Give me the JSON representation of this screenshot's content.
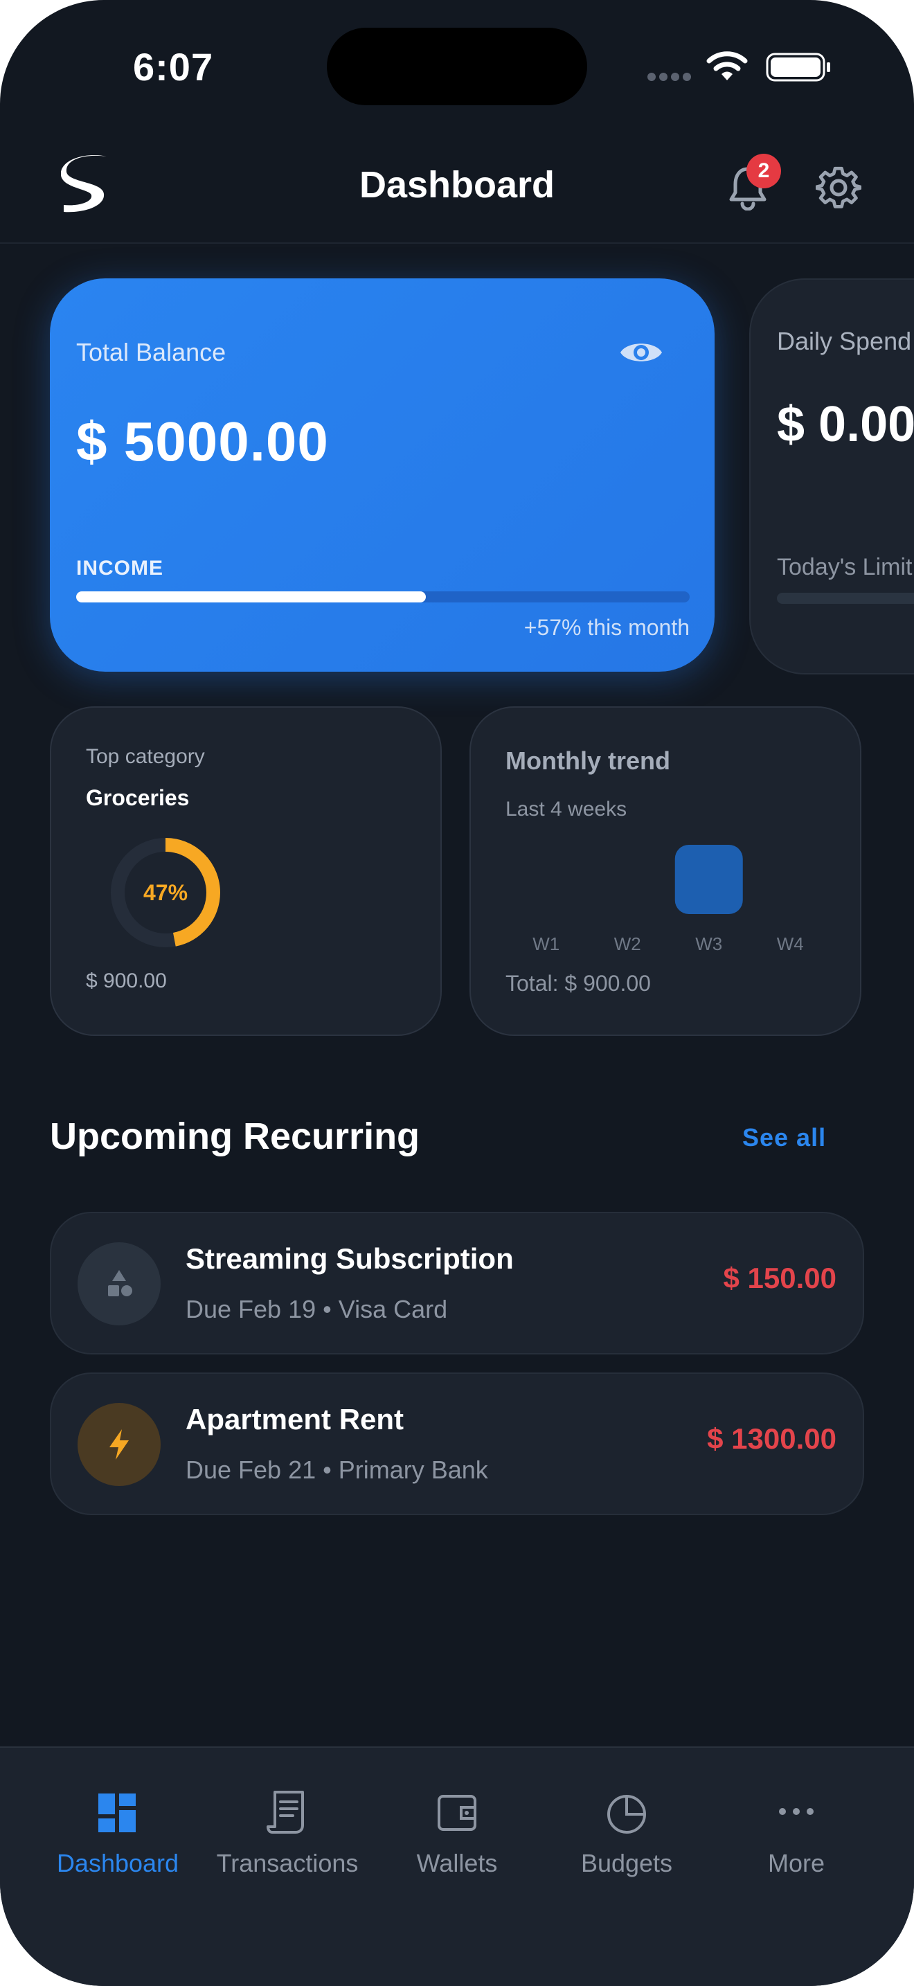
{
  "status_bar": {
    "time": "6:07"
  },
  "header": {
    "title": "Dashboard",
    "notification_count": "2"
  },
  "balance_card": {
    "label": "Total Balance",
    "amount": "$ 5000.00",
    "income_label": "INCOME",
    "income_progress": 0.57,
    "change_text": "+57% this month"
  },
  "daily_card": {
    "label": "Daily Spend",
    "amount": "$ 0.00",
    "limit_label": "Today's Limit"
  },
  "top_category": {
    "title": "Top category",
    "name": "Groceries",
    "percent_label": "47%",
    "percent": 0.47,
    "amount": "$ 900.00"
  },
  "monthly_trend": {
    "title": "Monthly trend",
    "subtitle": "Last 4 weeks",
    "total": "Total: $ 900.00"
  },
  "chart_data": {
    "type": "bar",
    "categories": [
      "W1",
      "W2",
      "W3",
      "W4"
    ],
    "values": [
      0,
      0,
      900,
      0
    ],
    "title": "Monthly trend",
    "xlabel": "",
    "ylabel": ""
  },
  "upcoming": {
    "title": "Upcoming Recurring",
    "see_all": "See all",
    "items": [
      {
        "name": "Streaming Subscription",
        "due": "Due Feb 19",
        "account": "Visa Card",
        "amount": "$ 150.00",
        "icon": "shapes-icon"
      },
      {
        "name": "Apartment Rent",
        "due": "Due Feb 21",
        "account": "Primary Bank",
        "amount": "$ 1300.00",
        "icon": "bolt-icon"
      }
    ]
  },
  "nav": {
    "items": [
      {
        "label": "Dashboard",
        "icon": "dashboard-icon",
        "active": true
      },
      {
        "label": "Transactions",
        "icon": "receipt-icon",
        "active": false
      },
      {
        "label": "Wallets",
        "icon": "wallet-icon",
        "active": false
      },
      {
        "label": "Budgets",
        "icon": "pie-chart-icon",
        "active": false
      },
      {
        "label": "More",
        "icon": "more-icon",
        "active": false
      }
    ]
  },
  "colors": {
    "background": "#121821",
    "card": "#1c232e",
    "accent": "#2b86ee",
    "expense": "#e3444b",
    "category": "#f7a823"
  }
}
